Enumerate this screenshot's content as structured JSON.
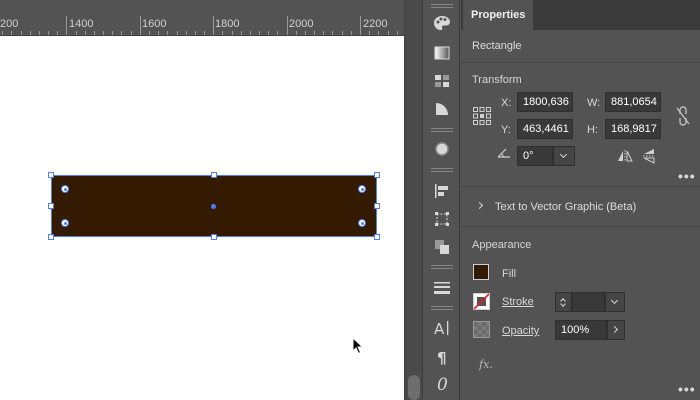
{
  "ruler": {
    "labels": [
      "200",
      "1400",
      "1600",
      "1800",
      "2000",
      "2200"
    ]
  },
  "panel": {
    "tab_label": "Properties",
    "object_type": "Rectangle",
    "transform": {
      "title": "Transform",
      "x_label": "X:",
      "x_value": "1800,636",
      "y_label": "Y:",
      "y_value": "463,4461",
      "w_label": "W:",
      "w_value": "881,0654",
      "h_label": "H:",
      "h_value": "168,9817",
      "rotate_value": "0°"
    },
    "text_to_vector": {
      "label": "Text to Vector Graphic (Beta)"
    },
    "appearance": {
      "title": "Appearance",
      "fill_label": "Fill",
      "stroke_label": "Stroke",
      "opacity_label": "Opacity",
      "opacity_value": "100%",
      "fx_label": "fx."
    }
  },
  "colors": {
    "fill": "#331a00",
    "selection": "#4f7df5"
  }
}
